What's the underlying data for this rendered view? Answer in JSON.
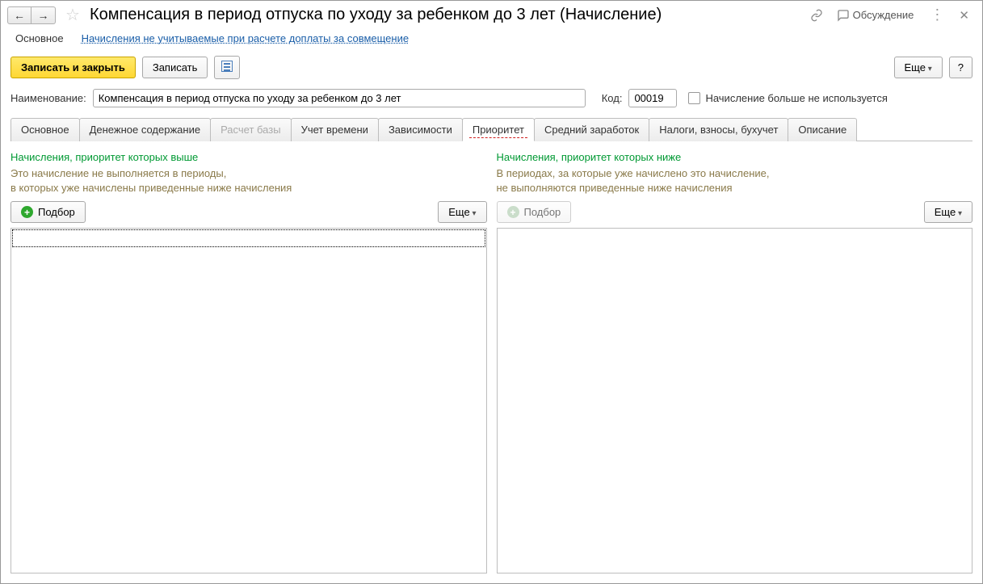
{
  "header": {
    "title": "Компенсация в период отпуска по уходу за ребенком до 3 лет (Начисление)",
    "discuss_label": "Обсуждение"
  },
  "navlinks": {
    "main": "Основное",
    "link1": "Начисления не учитываемые при расчете доплаты за совмещение"
  },
  "toolbar": {
    "save_close": "Записать и закрыть",
    "save": "Записать",
    "more": "Еще",
    "help": "?"
  },
  "form": {
    "name_label": "Наименование:",
    "name_value": "Компенсация в период отпуска по уходу за ребенком до 3 лет",
    "code_label": "Код:",
    "code_value": "00019",
    "notused_label": "Начисление больше не используется"
  },
  "tabs": {
    "t0": "Основное",
    "t1": "Денежное содержание",
    "t2": "Расчет базы",
    "t3": "Учет времени",
    "t4": "Зависимости",
    "t5": "Приоритет",
    "t6": "Средний заработок",
    "t7": "Налоги, взносы, бухучет",
    "t8": "Описание"
  },
  "priority": {
    "left": {
      "title": "Начисления, приоритет которых выше",
      "desc1": "Это начисление не выполняется в периоды,",
      "desc2": "в которых уже начислены приведенные ниже начисления",
      "podbor": "Подбор",
      "more": "Еще"
    },
    "right": {
      "title": "Начисления, приоритет которых ниже",
      "desc1": "В периодах, за которые уже начислено это начисление,",
      "desc2": "не выполняются приведенные ниже начисления",
      "podbor": "Подбор",
      "more": "Еще"
    }
  }
}
